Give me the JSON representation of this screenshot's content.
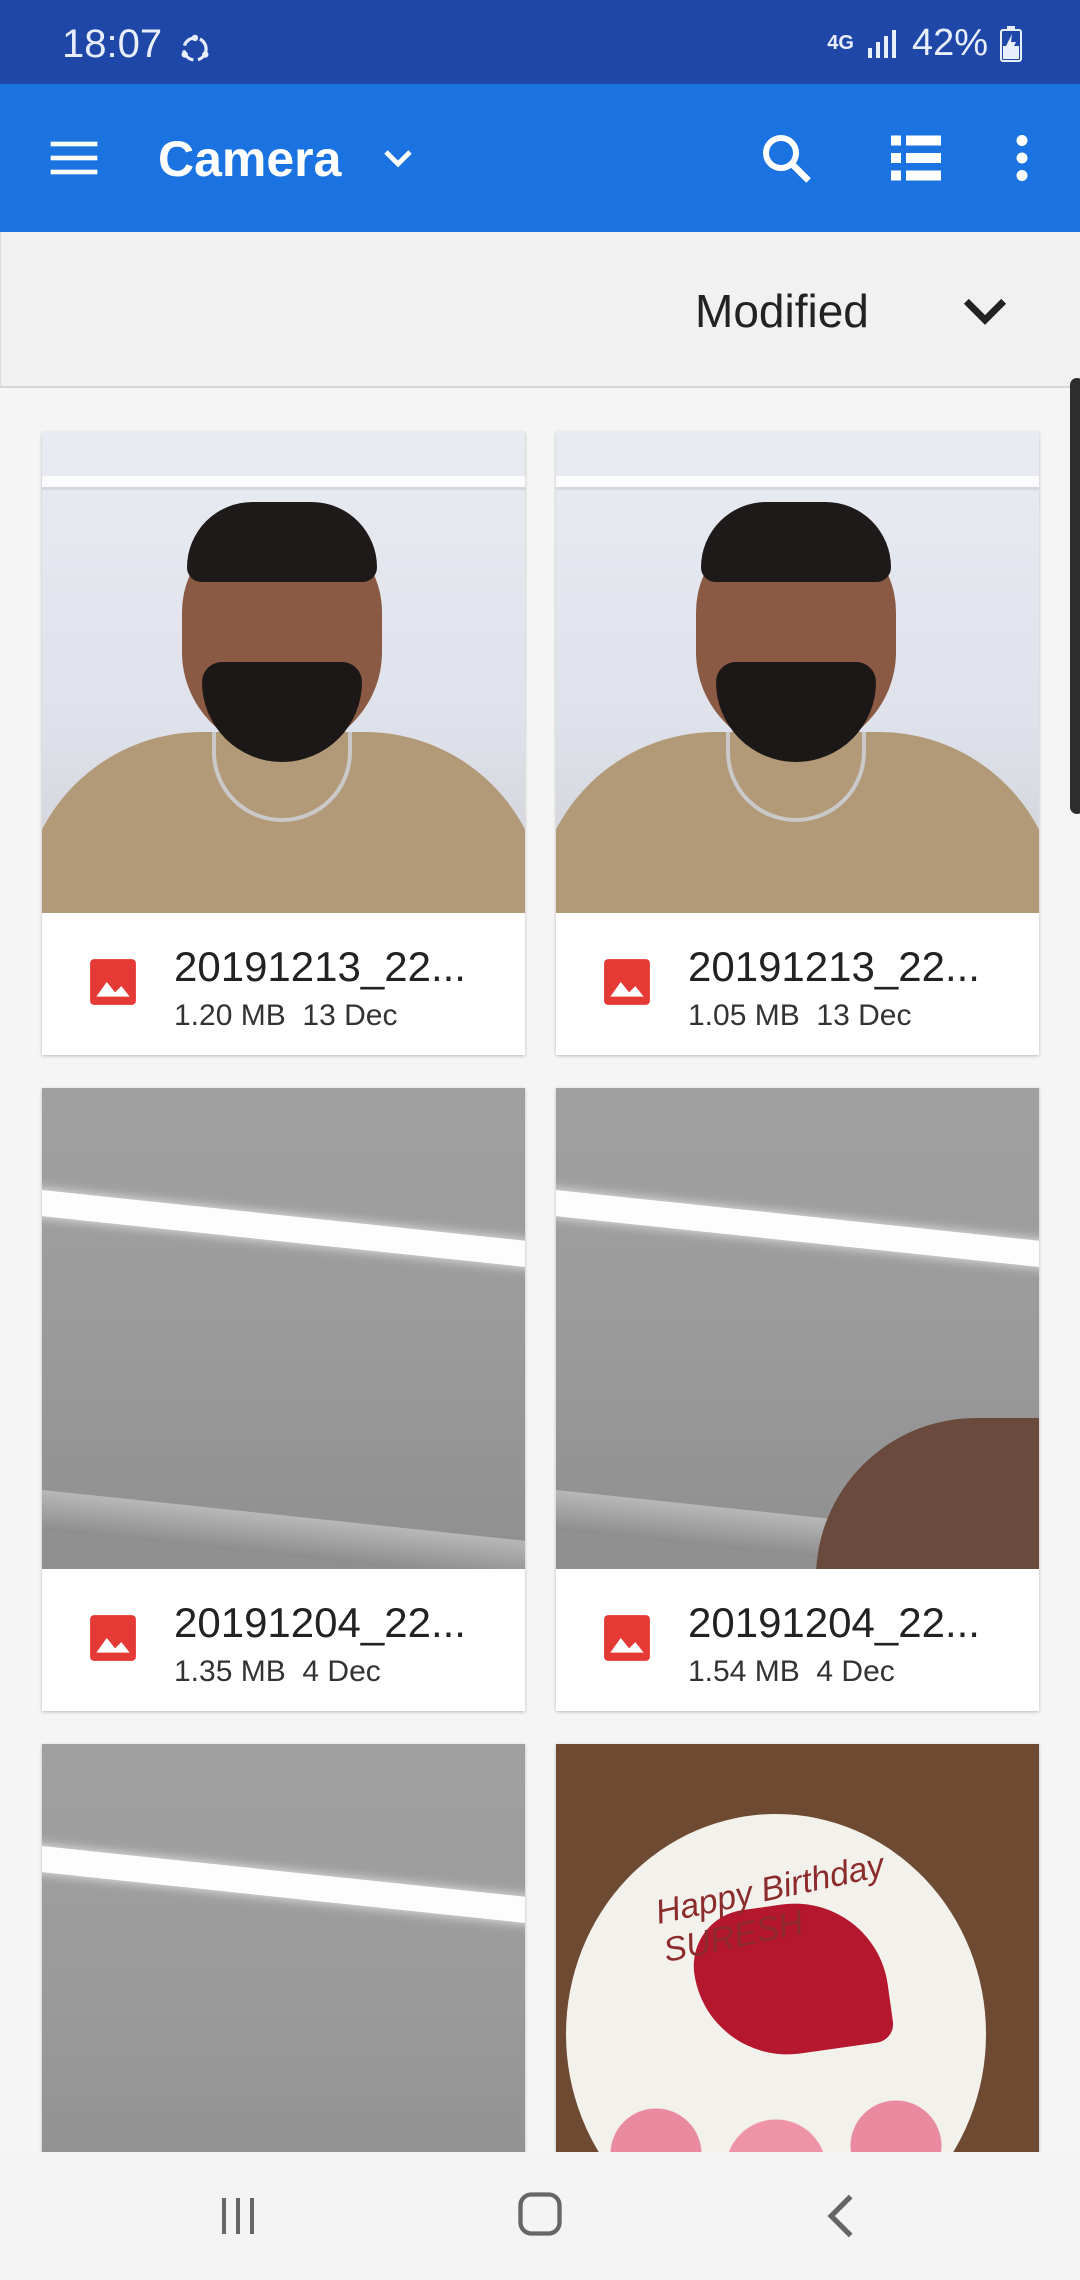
{
  "status_bar": {
    "time": "18:07",
    "network": "4G",
    "battery": "42%"
  },
  "app_bar": {
    "title": "Camera"
  },
  "sort_bar": {
    "label": "Modified"
  },
  "files": [
    {
      "name": "20191213_22...",
      "size": "1.20 MB",
      "date": "13 Dec",
      "thumb": "person"
    },
    {
      "name": "20191213_22...",
      "size": "1.05 MB",
      "date": "13 Dec",
      "thumb": "person"
    },
    {
      "name": "20191204_22...",
      "size": "1.35 MB",
      "date": "4 Dec",
      "thumb": "ceiling"
    },
    {
      "name": "20191204_22...",
      "size": "1.54 MB",
      "date": "4 Dec",
      "thumb": "ceiling-hand"
    },
    {
      "name": "",
      "size": "",
      "date": "",
      "thumb": "ceiling"
    },
    {
      "name": "",
      "size": "",
      "date": "",
      "thumb": "cake",
      "caption": "Happy Birthday SURESH"
    }
  ],
  "colors": {
    "status_bar": "#1e47a8",
    "app_bar": "#1a73e0",
    "image_icon": "#e53935"
  }
}
